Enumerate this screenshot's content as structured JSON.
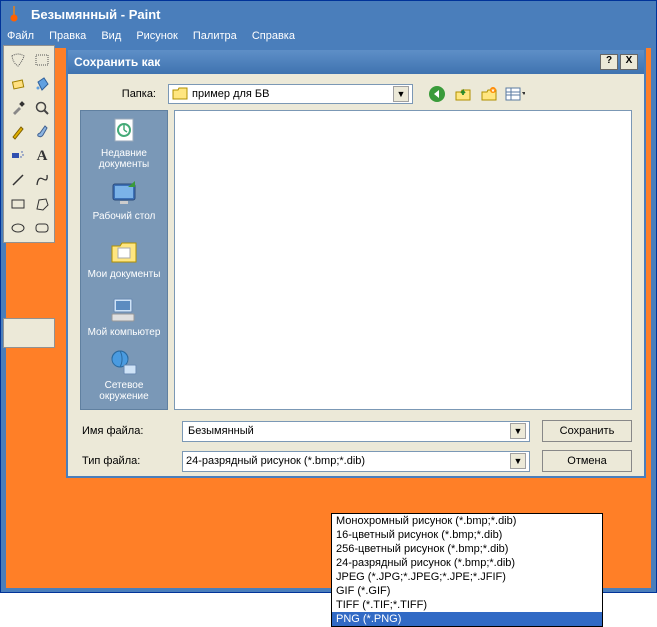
{
  "window": {
    "title": "Безымянный - Paint"
  },
  "menubar": {
    "file": "Файл",
    "edit": "Правка",
    "view": "Вид",
    "image": "Рисунок",
    "palette": "Палитра",
    "help": "Справка"
  },
  "dialog": {
    "title": "Сохранить как",
    "help_btn": "?",
    "close_btn": "X",
    "save_in_label": "Папка:",
    "save_in_value": "пример для БВ",
    "places": {
      "recent": "Недавние документы",
      "desktop": "Рабочий стол",
      "mydocs": "Мои документы",
      "mycomp": "Мой компьютер",
      "network": "Сетевое окружение"
    },
    "filename_label": "Имя файла:",
    "filename_value": "Безымянный",
    "filetype_label": "Тип файла:",
    "filetype_value": "24-разрядный рисунок (*.bmp;*.dib)",
    "save_btn": "Сохранить",
    "cancel_btn": "Отмена",
    "filetype_options": [
      "Монохромный рисунок (*.bmp;*.dib)",
      "16-цветный рисунок (*.bmp;*.dib)",
      "256-цветный рисунок (*.bmp;*.dib)",
      "24-разрядный рисунок (*.bmp;*.dib)",
      "JPEG (*.JPG;*.JPEG;*.JPE;*.JFIF)",
      "GIF (*.GIF)",
      "TIFF (*.TIF;*.TIFF)",
      "PNG (*.PNG)"
    ],
    "highlighted_index": 7
  }
}
